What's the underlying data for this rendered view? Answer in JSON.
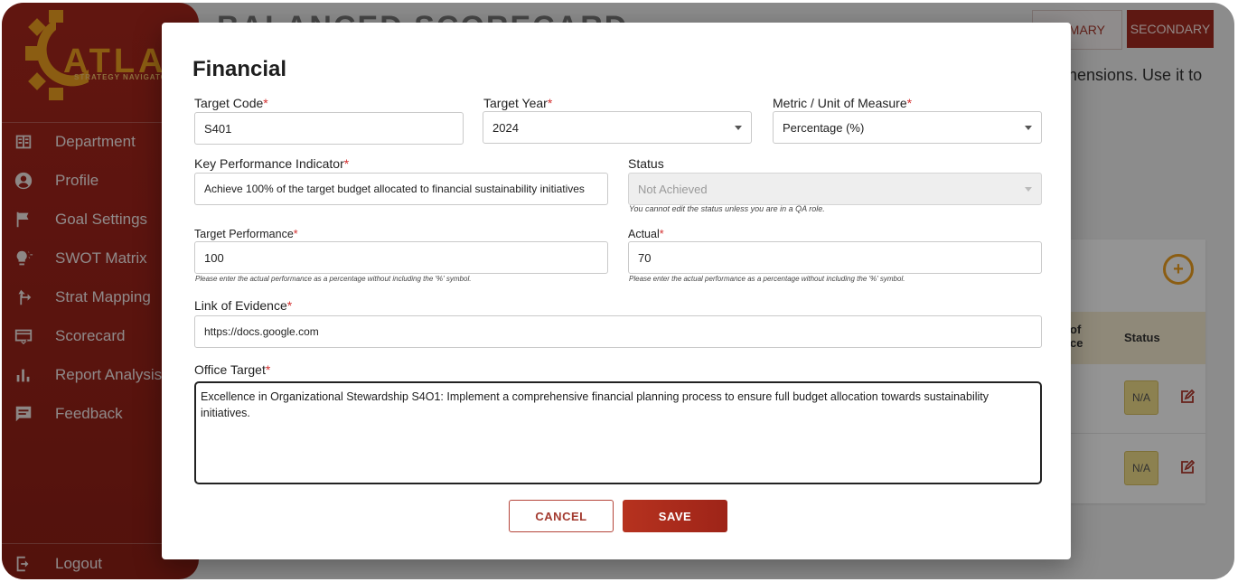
{
  "app": {
    "logo_text": "ATLAS",
    "logo_sub": "STRATEGY NAVIGATOR",
    "page_title": "BALANCED SCORECARD",
    "bg_description": "nensions. Use it to",
    "btn_primary": "MARY",
    "btn_secondary": "SECONDARY"
  },
  "sidebar": {
    "items": [
      {
        "label": "Department",
        "icon": "department-icon"
      },
      {
        "label": "Profile",
        "icon": "profile-icon"
      },
      {
        "label": "Goal Settings",
        "icon": "flag-icon"
      },
      {
        "label": "SWOT Matrix",
        "icon": "lightbulb-icon"
      },
      {
        "label": "Strat Mapping",
        "icon": "strategy-map-icon"
      },
      {
        "label": "Scorecard",
        "icon": "scorecard-icon"
      },
      {
        "label": "Report Analysis",
        "icon": "bar-chart-icon"
      },
      {
        "label": "Feedback",
        "icon": "feedback-icon"
      }
    ],
    "logout": "Logout"
  },
  "bg_table": {
    "col1_line1": "of",
    "col1_line2": "ce",
    "col2": "Status",
    "rows": [
      {
        "status": "N/A"
      },
      {
        "status": "N/A"
      }
    ]
  },
  "modal": {
    "title": "Financial",
    "target_code": {
      "label": "Target Code",
      "value": "S401"
    },
    "target_year": {
      "label": "Target Year",
      "value": "2024"
    },
    "metric": {
      "label": "Metric / Unit of Measure",
      "value": "Percentage (%)"
    },
    "kpi": {
      "label": "Key Performance Indicator",
      "value": "Achieve 100% of the target budget allocated to financial sustainability initiatives"
    },
    "status": {
      "label": "Status",
      "value": "Not Achieved",
      "hint": "You cannot edit the status unless you are in a QA role."
    },
    "target_performance": {
      "label": "Target Performance",
      "value": "100",
      "hint": "Please enter the actual performance as a percentage without including the '%' symbol."
    },
    "actual": {
      "label": "Actual",
      "value": "70",
      "hint": "Please enter the actual performance as a percentage without including the '%' symbol."
    },
    "evidence": {
      "label": "Link of Evidence",
      "value": "https://docs.google.com"
    },
    "office_target": {
      "label": "Office Target",
      "value": "Excellence in Organizational Stewardship S4O1: Implement a comprehensive financial planning process to ensure full budget allocation towards sustainability initiatives."
    },
    "cancel_label": "CANCEL",
    "save_label": "SAVE"
  },
  "colors": {
    "brand": "#a8261c",
    "accent": "#f0a020",
    "required": "#d32f2f"
  }
}
